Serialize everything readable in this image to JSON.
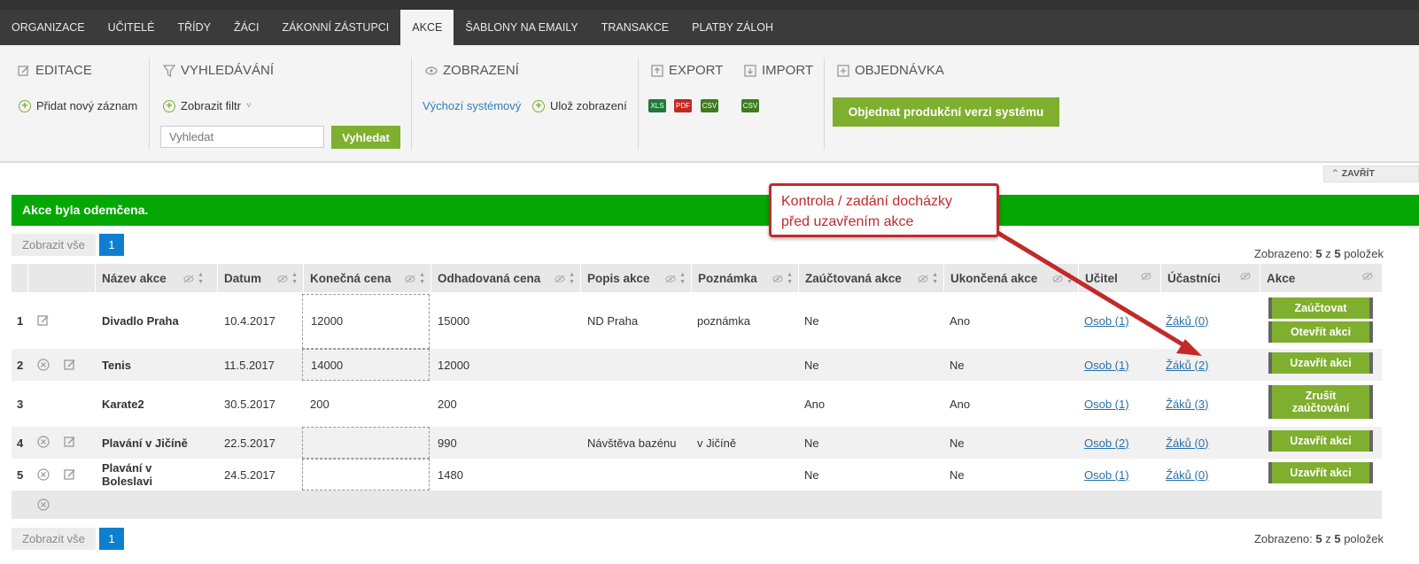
{
  "nav": {
    "items": [
      "ORGANIZACE",
      "UČITELÉ",
      "TŘÍDY",
      "ŽÁCI",
      "ZÁKONNÍ ZÁSTUPCI",
      "AKCE",
      "ŠABLONY NA EMAILY",
      "TRANSAKCE",
      "PLATBY ZÁLOH"
    ],
    "active": "AKCE"
  },
  "toolbar": {
    "editace": {
      "title": "EDITACE",
      "add_label": "Přidat nový záznam"
    },
    "vyhledavani": {
      "title": "VYHLEDÁVÁNÍ",
      "filter_label": "Zobrazit filtr",
      "search_placeholder": "Vyhledat",
      "search_button": "Vyhledat"
    },
    "zobrazeni": {
      "title": "ZOBRAZENÍ",
      "default_label": "Výchozí systémový",
      "save_label": "Ulož zobrazení"
    },
    "export": {
      "title": "EXPORT",
      "formats": [
        "XLS",
        "PDF",
        "CSV"
      ]
    },
    "import": {
      "title": "IMPORT",
      "formats": [
        "CSV"
      ]
    },
    "objednavka": {
      "title": "OBJEDNÁVKA",
      "button": "Objednat produkční verzi systému"
    }
  },
  "close_label": "ZAVŘÍT",
  "alert": "Akce byla odemčena.",
  "pager": {
    "show_all": "Zobrazit vše",
    "page": "1",
    "shown_prefix": "Zobrazeno:",
    "shown_count": "5",
    "shown_of": "z",
    "shown_total": "5",
    "shown_suffix": "položek"
  },
  "table": {
    "columns": [
      "Název akce",
      "Datum",
      "Konečná cena",
      "Odhadovaná cena",
      "Popis akce",
      "Poznámka",
      "Zaúčtovaná akce",
      "Ukončená akce",
      "Učitel",
      "Účastníci",
      "Akce"
    ],
    "rows": [
      {
        "num": "1",
        "name": "Divadlo Praha",
        "date": "10.4.2017",
        "final_price": "12000",
        "est_price": "15000",
        "desc": "ND Praha",
        "note": "poznámka",
        "booked": "Ne",
        "finished": "Ano",
        "teacher": "Osob (1)",
        "participants": "Žáků (0)",
        "actions": [
          "Zaúčtovat",
          "Otevřít akci"
        ]
      },
      {
        "num": "2",
        "name": "Tenis",
        "date": "11.5.2017",
        "final_price": "14000",
        "est_price": "12000",
        "desc": "",
        "note": "",
        "booked": "Ne",
        "finished": "Ne",
        "teacher": "Osob (1)",
        "participants": "Žáků (2)",
        "actions": [
          "Uzavřít akci"
        ]
      },
      {
        "num": "3",
        "name": "Karate2",
        "date": "30.5.2017",
        "final_price": "200",
        "est_price": "200",
        "desc": "",
        "note": "",
        "booked": "Ano",
        "finished": "Ano",
        "teacher": "Osob (1)",
        "participants": "Žáků (3)",
        "actions": [
          "Zrušit zaúčtování"
        ]
      },
      {
        "num": "4",
        "name": "Plavání v Jičíně",
        "date": "22.5.2017",
        "final_price": "",
        "est_price": "990",
        "desc": "Návštěva bazénu",
        "note": "v Jičíně",
        "booked": "Ne",
        "finished": "Ne",
        "teacher": "Osob (2)",
        "participants": "Žáků (0)",
        "actions": [
          "Uzavřít akci"
        ]
      },
      {
        "num": "5",
        "name": "Plavání v Boleslavi",
        "date": "24.5.2017",
        "final_price": "",
        "est_price": "1480",
        "desc": "",
        "note": "",
        "booked": "Ne",
        "finished": "Ne",
        "teacher": "Osob (1)",
        "participants": "Žáků (0)",
        "actions": [
          "Uzavřít akci"
        ]
      }
    ]
  },
  "callout": {
    "line1": "Kontrola / zadání docházky",
    "line2": "před uzavřením akce"
  }
}
